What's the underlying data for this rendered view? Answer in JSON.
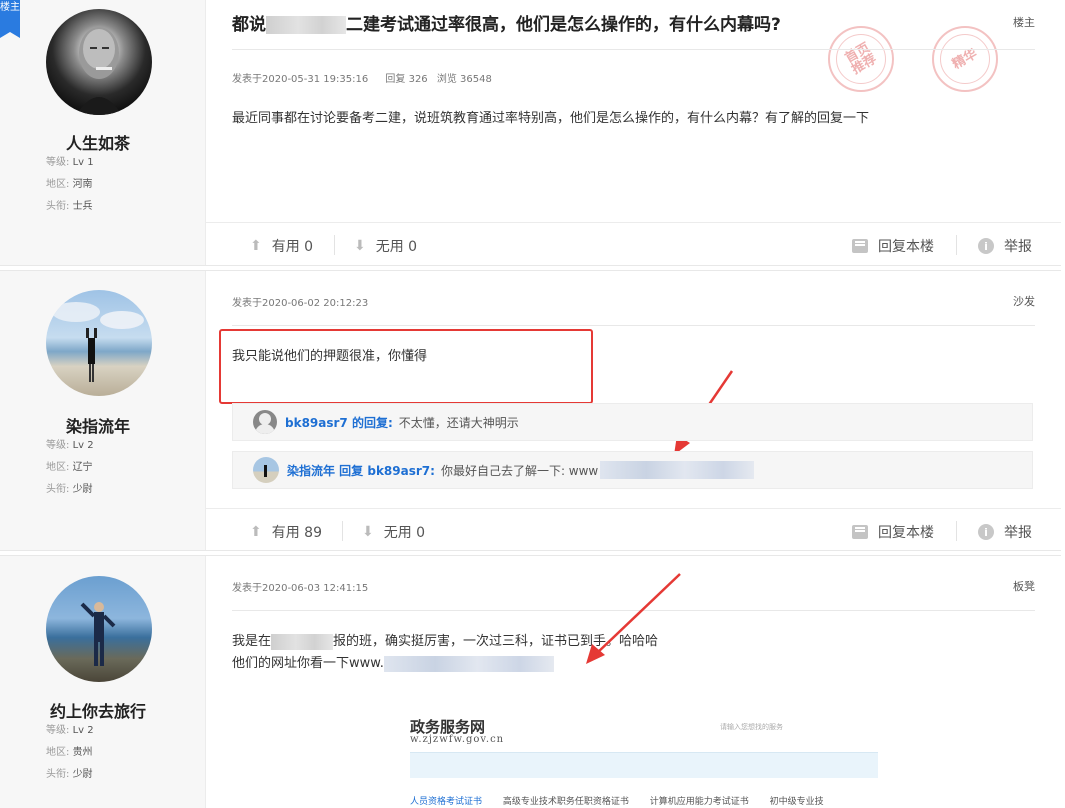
{
  "badge": "楼主",
  "posts": [
    {
      "user": {
        "name": "人生如茶",
        "level_label": "等级:",
        "level": "Lv 1",
        "region_label": "地区:",
        "region": "河南",
        "rank_label": "头衔:",
        "rank": "士兵"
      },
      "title_prefix": "都说",
      "title_suffix": "二建考试通过率很高，他们是怎么操作的，有什么内幕吗?",
      "floor": "楼主",
      "posted_at": "发表于2020-05-31 19:35:16",
      "replies": "回复 326",
      "views": "浏览 36548",
      "content": "最近同事都在讨论要备考二建，说班筑教育通过率特别高，他们是怎么操作的，有什么内幕？有了解的回复一下",
      "stamps": [
        "首页推荐",
        "精华"
      ],
      "useful": "有用 0",
      "useless": "无用 0",
      "reply_floor": "回复本楼",
      "report": "举报"
    },
    {
      "user": {
        "name": "染指流年",
        "level_label": "等级:",
        "level": "Lv 2",
        "region_label": "地区:",
        "region": "辽宁",
        "rank_label": "头衔:",
        "rank": "少尉"
      },
      "floor": "沙发",
      "posted_at": "发表于2020-06-02 20:12:23",
      "content": "我只能说他们的押题很准，你懂得",
      "sub_replies": [
        {
          "name": "bk89asr7 的回复:",
          "text": "不太懂，还请大神明示"
        },
        {
          "name": "染指流年 回复 bk89asr7:",
          "text": "你最好自己去了解一下: www"
        }
      ],
      "useful": "有用 89",
      "useless": "无用 0",
      "reply_floor": "回复本楼",
      "report": "举报"
    },
    {
      "user": {
        "name": "约上你去旅行",
        "level_label": "等级:",
        "level": "Lv 2",
        "region_label": "地区:",
        "region": "贵州",
        "rank_label": "头衔:",
        "rank": "少尉"
      },
      "floor": "板凳",
      "posted_at": "发表于2020-06-03 12:41:15",
      "content_line1_a": "我是在",
      "content_line1_b": "报的班，确实挺厉害，一次过三科，证书已到手。哈哈哈",
      "content_line2": "他们的网址你看一下www.",
      "screenshot": {
        "logo": "政务服务网",
        "url": "w.zjzwfw.gov.cn",
        "hint": "请输入您想找的服务",
        "tabs": [
          "人员资格考试证书",
          "高级专业技术职务任职资格证书",
          "计算机应用能力考试证书",
          "初中级专业技"
        ]
      }
    }
  ]
}
